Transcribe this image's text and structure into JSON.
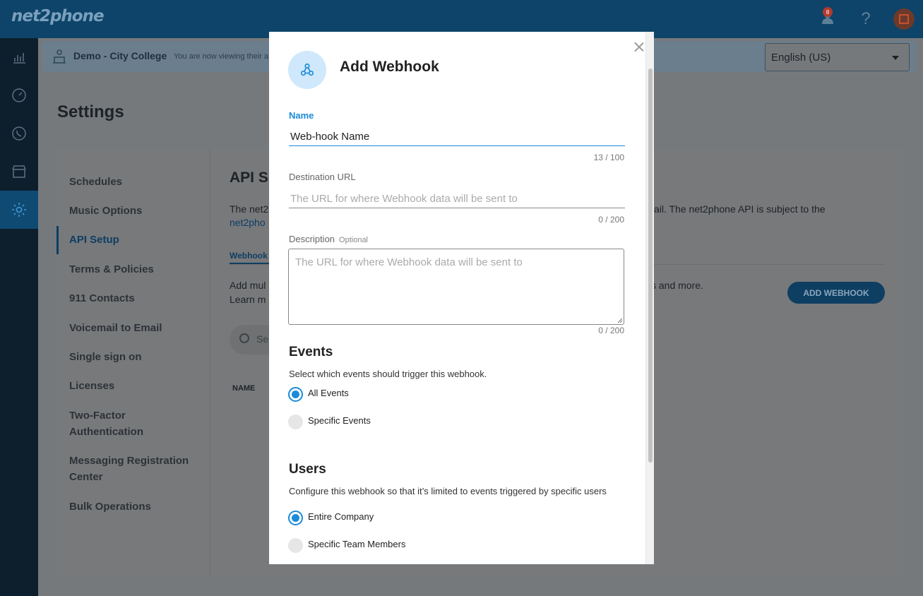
{
  "app": {
    "logo": "net2phone",
    "notification_count": "8",
    "help_icon": "?"
  },
  "banner": {
    "title": "Demo - City College",
    "subtitle": "You are now viewing their a"
  },
  "language": {
    "selected": "English (US)"
  },
  "settings": {
    "title": "Settings",
    "menu": [
      {
        "label": "Schedules"
      },
      {
        "label": "Music Options"
      },
      {
        "label": "API Setup"
      },
      {
        "label": "Terms & Policies"
      },
      {
        "label": "911 Contacts"
      },
      {
        "label": "Voicemail to Email"
      },
      {
        "label": "Single sign on"
      },
      {
        "label": "Licenses"
      },
      {
        "label": "Two-Factor Authentication"
      },
      {
        "label": "Messaging Registration Center"
      },
      {
        "label": "Bulk Operations"
      }
    ],
    "api_title": "API S",
    "api_text_left": "The net2",
    "api_text_right": "ail. The net2phone API is subject to the",
    "api_link": "net2pho",
    "tab": "Webhook",
    "add_text_left": "Add mul",
    "add_text_left2": "Learn m",
    "add_text_right": "s and more.",
    "add_button": "ADD WEBHOOK",
    "search_partial": "Se",
    "col_name": "NAME"
  },
  "modal": {
    "title": "Add Webhook",
    "name": {
      "label": "Name",
      "value": "Web-hook Name",
      "counter": "13 / 100"
    },
    "destination": {
      "label": "Destination URL",
      "placeholder": "The URL for where Webhook data will be sent to",
      "counter": "0 / 200"
    },
    "description": {
      "label": "Description",
      "optional": "Optional",
      "placeholder": "The URL for where Webhook data will be sent to",
      "counter": "0 / 200"
    },
    "events": {
      "title": "Events",
      "desc": "Select which events should trigger this webhook.",
      "options": [
        "All Events",
        "Specific Events"
      ],
      "selected": "All Events"
    },
    "users": {
      "title": "Users",
      "desc": "Configure this webhook so that it’s limited to events triggered by specific users",
      "options": [
        "Entire Company",
        "Specific Team Members"
      ],
      "selected": "Entire Company"
    }
  },
  "colors": {
    "topbar": "#0e4469",
    "accent": "#1a8bd9",
    "overlay": "#6b6f72"
  }
}
